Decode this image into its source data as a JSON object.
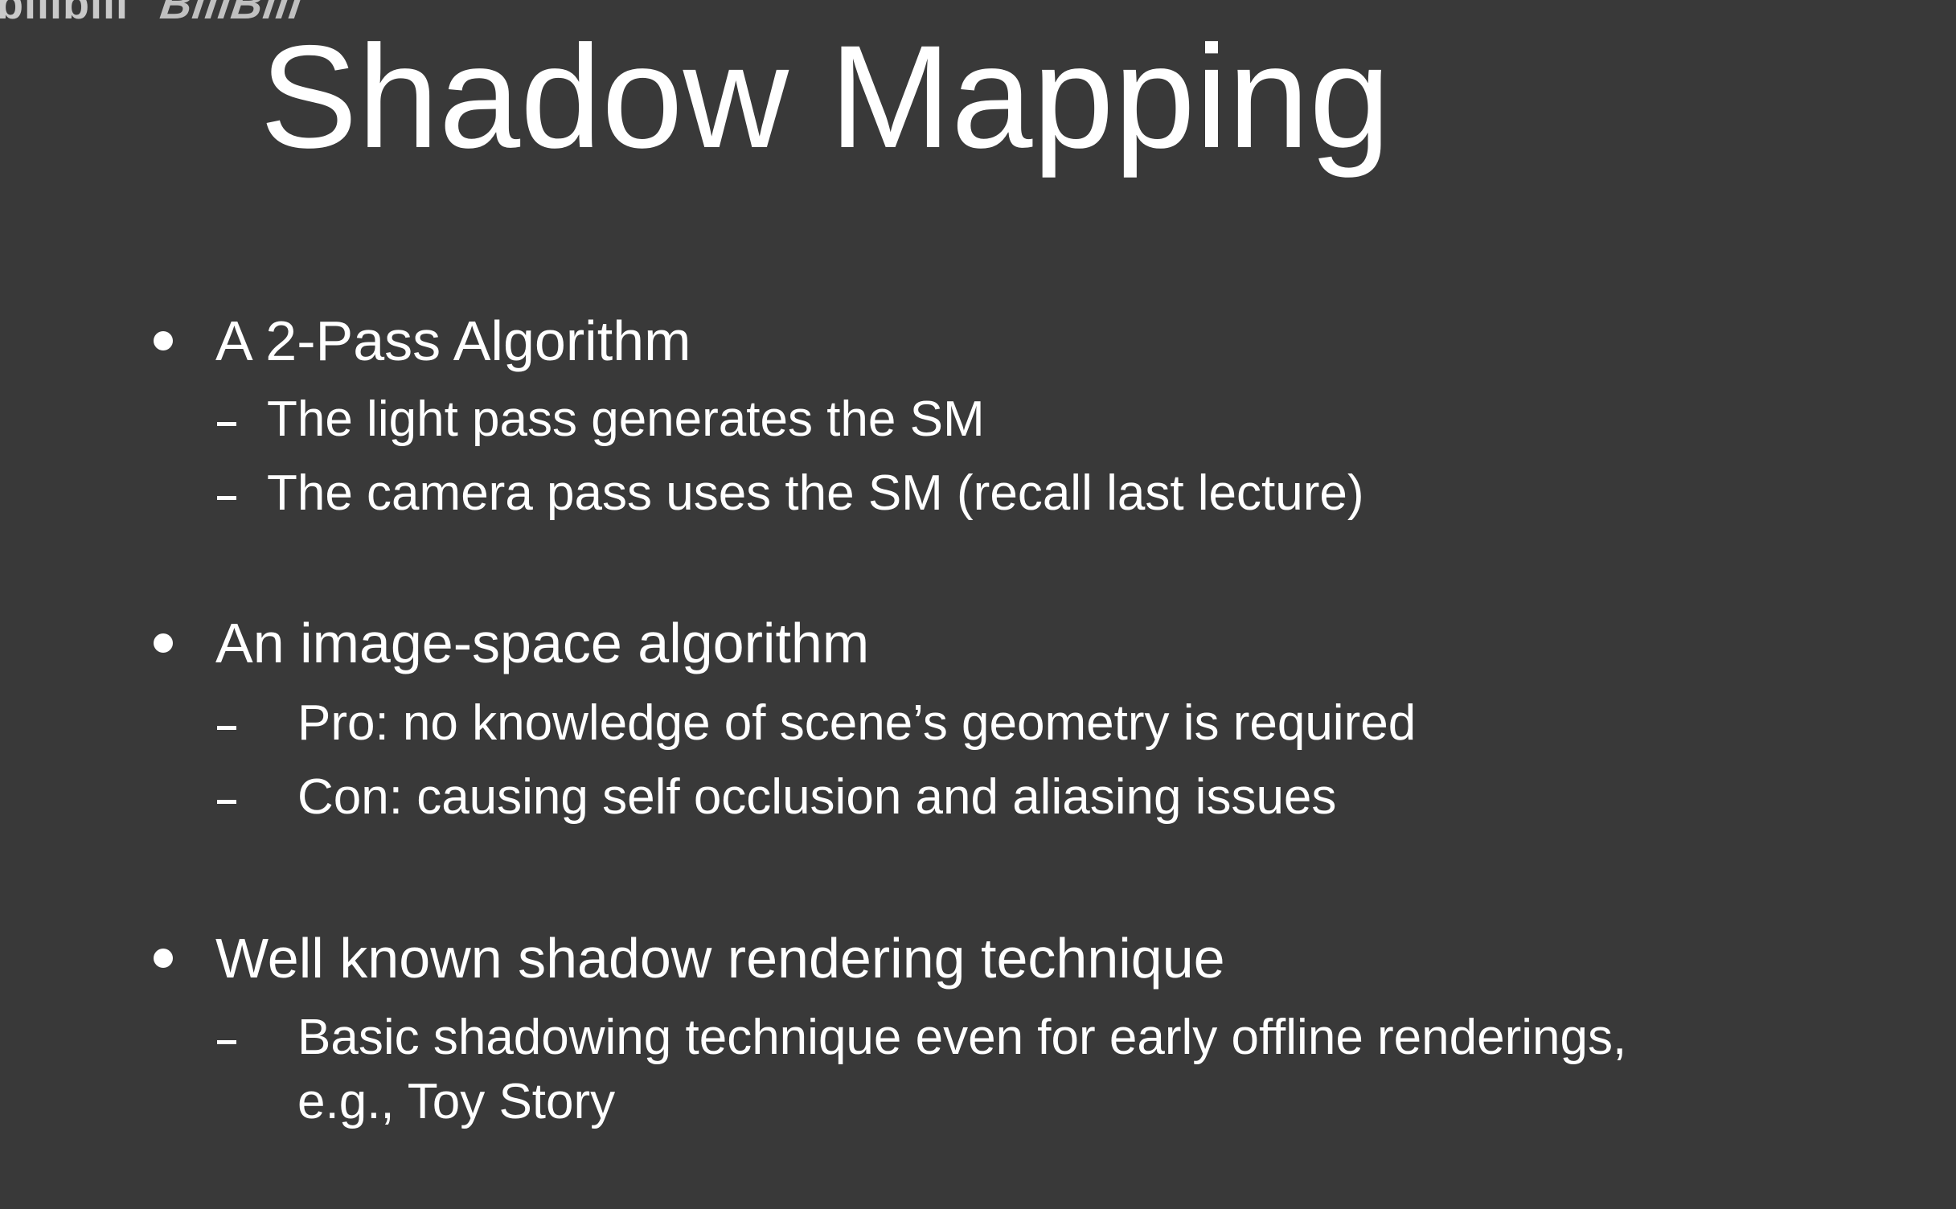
{
  "watermark": {
    "text": "bilibili",
    "logo": "BiliBili"
  },
  "slide": {
    "title": "Shadow Mapping",
    "bullets": [
      {
        "text": "A 2-Pass Algorithm",
        "subs": [
          "The light pass generates the SM",
          "The camera pass uses the SM (recall last lecture)"
        ]
      },
      {
        "text": "An image-space algorithm",
        "subs": [
          "Pro: no knowledge of scene’s geometry is required",
          "Con: causing self occlusion and aliasing issues"
        ]
      },
      {
        "text": "Well known shadow rendering technique",
        "subs": [
          "Basic shadowing technique even for early offline renderings,",
          "e.g., Toy Story"
        ]
      }
    ]
  },
  "colors": {
    "background": "#393939",
    "text": "#ffffff"
  }
}
